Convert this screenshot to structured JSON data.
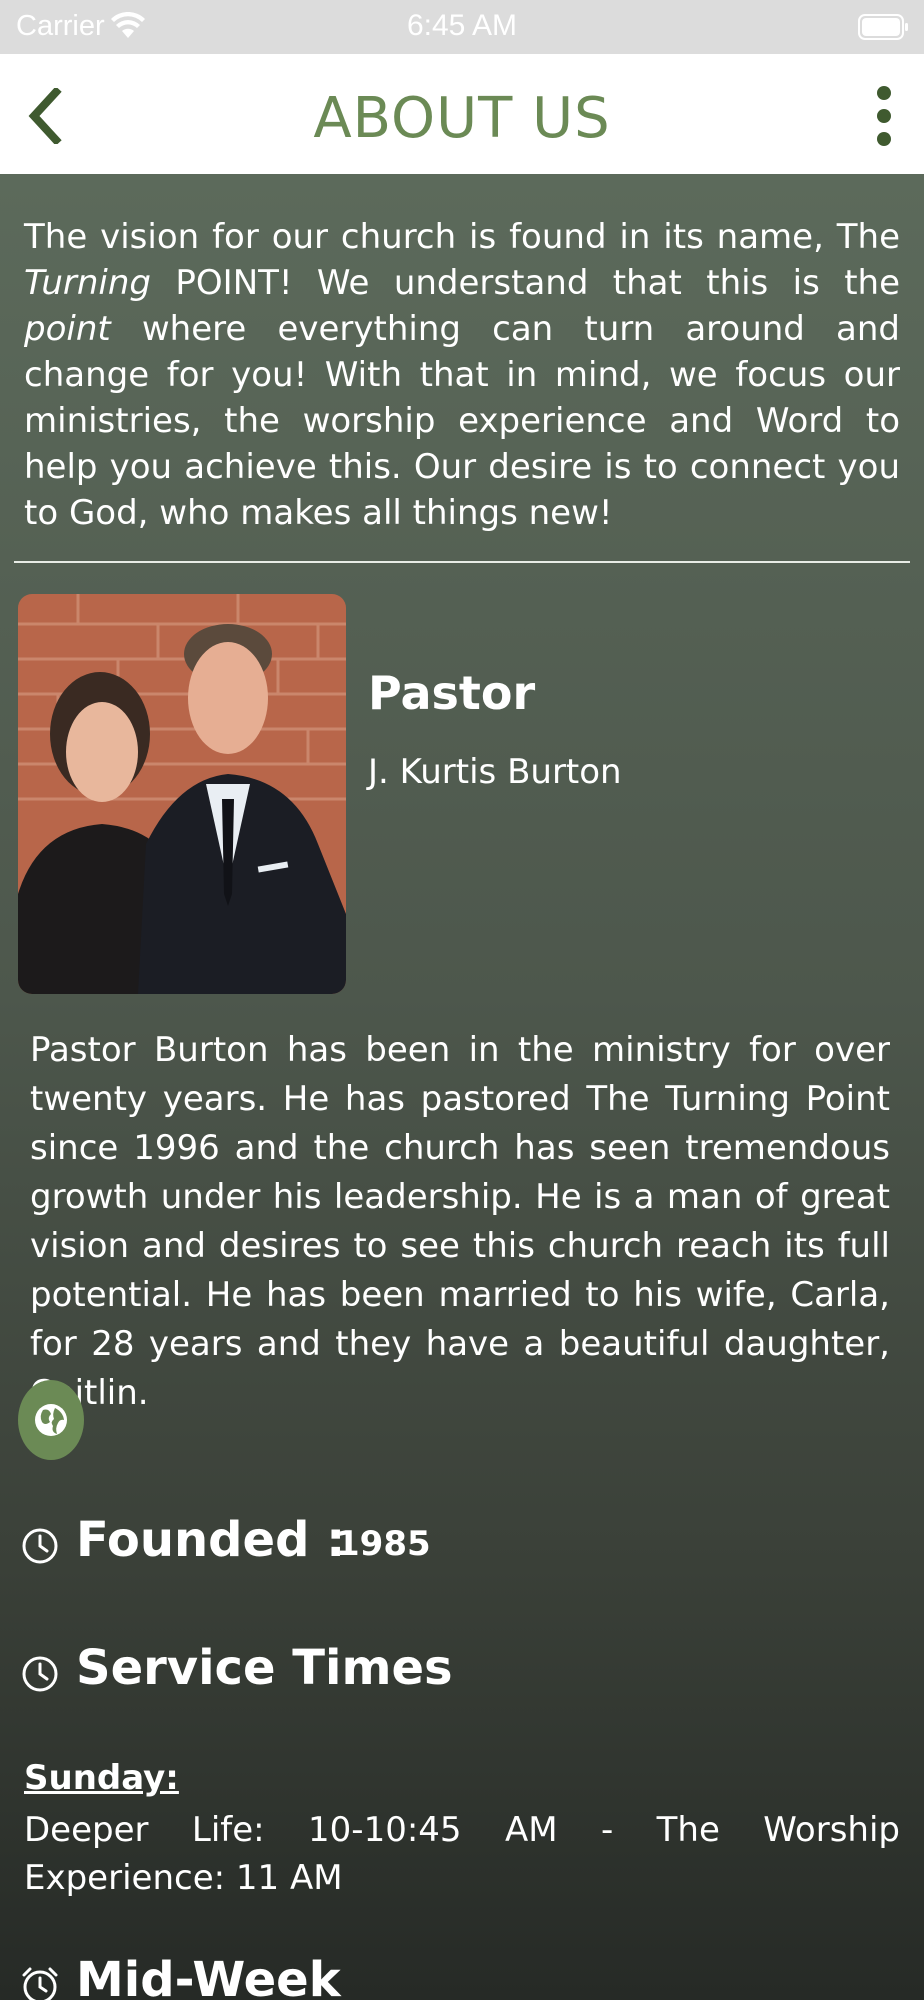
{
  "status_bar": {
    "carrier": "Carrier",
    "time": "6:45 AM"
  },
  "nav": {
    "title": "ABOUT US",
    "back_icon": "chevron-left-icon",
    "more_icon": "vertical-ellipsis-icon"
  },
  "intro": {
    "part1": "The vision for our church is found in its name, The ",
    "italic1": "Turning",
    "part2": " POINT!  We understand that this is the ",
    "italic2": "point",
    "part3": " where everything can turn around and change for you!  With that in mind, we focus our ministries, the worship experience and Word to help you achieve this.  Our desire is to connect you to God, who makes all things new!"
  },
  "pastor": {
    "role": "Pastor",
    "name": "J. Kurtis Burton",
    "bio": "Pastor Burton has been in the ministry for over twenty years. He has pastored The Turning Point since 1996 and the church has seen tremendous growth under his leadership. He is a man of great vision and desires to see this church reach its full potential. He has been married to his wife, Carla, for 28 years and they have a beautiful daughter, Caitlin."
  },
  "website_button_icon": "globe-icon",
  "founded": {
    "label": "Founded :",
    "value": "1985"
  },
  "service_times": {
    "heading": "Service Times",
    "sunday_label": "Sunday: ",
    "sunday_times": "Deeper Life: 10-10:45 AM  - The Worship Experience: 11 AM"
  },
  "midweek": {
    "heading": "Mid-Week"
  },
  "colors": {
    "accent_green": "#6b8a55",
    "nav_icon_dark_green": "#3f5a2f",
    "background_top": "#5c6a5b",
    "background_bottom": "#262a26"
  }
}
